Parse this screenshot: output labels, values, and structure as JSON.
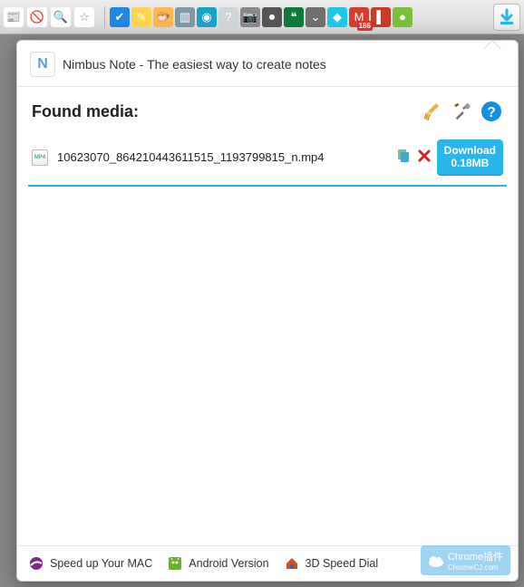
{
  "toolbar": {
    "icons": [
      {
        "name": "news-icon",
        "bg": "#fff",
        "glyph": "📰"
      },
      {
        "name": "block-icon",
        "bg": "#fff",
        "glyph": "🚫"
      },
      {
        "name": "zoom-out-icon",
        "bg": "#fff",
        "glyph": "🔍"
      },
      {
        "name": "star-icon",
        "bg": "#fff",
        "glyph": "☆"
      }
    ],
    "extensions": [
      {
        "name": "check-icon",
        "bg": "#1e88e5",
        "glyph": "✔"
      },
      {
        "name": "note-icon",
        "bg": "#ffd54f",
        "glyph": "✎"
      },
      {
        "name": "blowfish-icon",
        "bg": "#ffb74d",
        "glyph": "🐡"
      },
      {
        "name": "tray-icon",
        "bg": "#7e9aa8",
        "glyph": "▥"
      },
      {
        "name": "eye-icon",
        "bg": "#1aa3c9",
        "glyph": "◉"
      },
      {
        "name": "help-icon",
        "bg": "#cfd6da",
        "glyph": "?"
      },
      {
        "name": "camera-icon",
        "bg": "#888",
        "glyph": "📷"
      },
      {
        "name": "record-icon",
        "bg": "#555",
        "glyph": "⏺"
      },
      {
        "name": "hangouts-icon",
        "bg": "#0e7a3c",
        "glyph": "❝"
      },
      {
        "name": "pocket-icon",
        "bg": "#6f6f6f",
        "glyph": "⌄"
      },
      {
        "name": "diamond-icon",
        "bg": "#1ec8e8",
        "glyph": "◆"
      },
      {
        "name": "mail-icon",
        "bg": "#db3b2a",
        "glyph": "M",
        "badge": "186"
      },
      {
        "name": "book-icon",
        "bg": "#c63b2a",
        "glyph": "▌"
      },
      {
        "name": "dot-icon",
        "bg": "#7bbf3a",
        "glyph": "●"
      }
    ]
  },
  "promo": {
    "text": "Nimbus Note - The easiest way to create notes",
    "logo": "N"
  },
  "header": {
    "title": "Found media:"
  },
  "media": [
    {
      "filename": "10623070_864210443611515_1193799815_n.mp4",
      "download_label": "Download",
      "size_label": "0.18MB"
    }
  ],
  "footer": {
    "link1": "Speed up Your MAC",
    "link2": "Android Version",
    "link3": "3D Speed Dial"
  },
  "watermark": {
    "label_top": "Chrome插件",
    "label_bottom": "ChromeCJ.com"
  }
}
